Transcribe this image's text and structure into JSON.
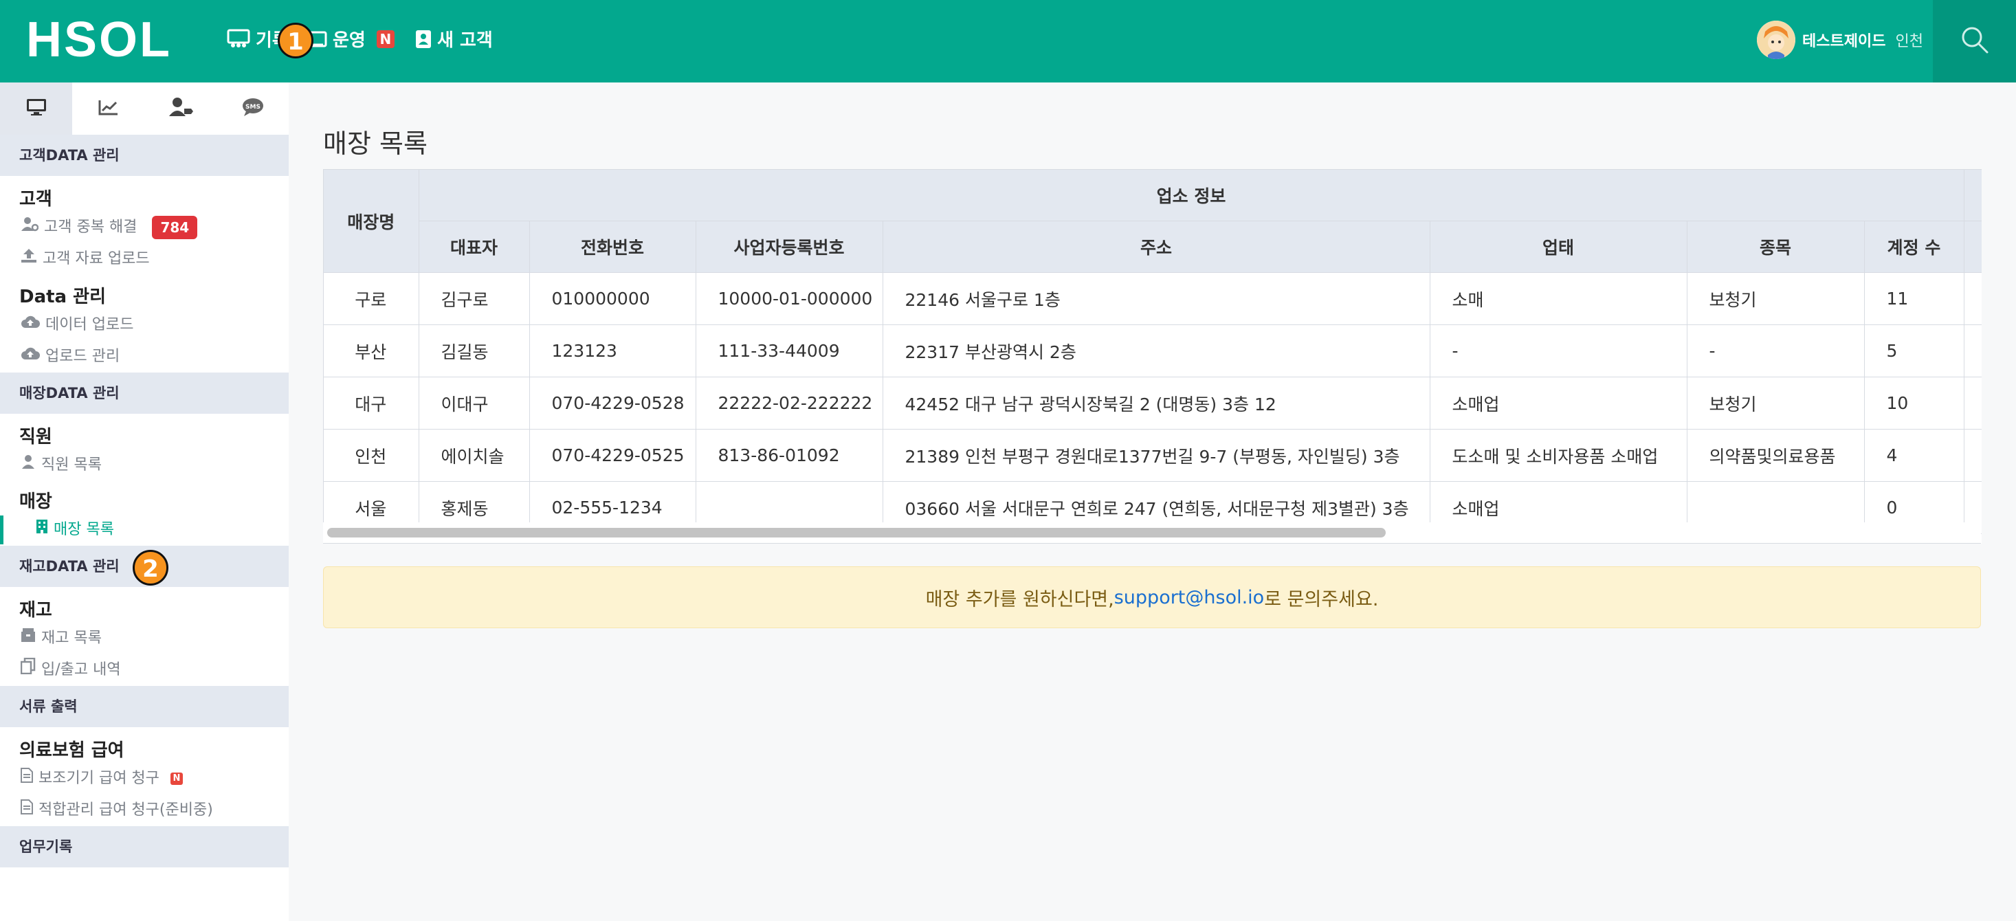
{
  "brand": "HSOL",
  "nav": {
    "items": [
      {
        "label": "기록"
      },
      {
        "label": "운영",
        "badge": "N"
      },
      {
        "label": "새 고객"
      }
    ],
    "marker1": "1"
  },
  "user": {
    "name": "테스트제이드",
    "branch": "인천"
  },
  "sidebar": {
    "tabs": [
      "monitor-icon",
      "chart-icon",
      "user-tag-icon",
      "sms-icon"
    ],
    "sections": {
      "customer_data": "고객DATA 관리",
      "store_data": "매장DATA 관리",
      "inventory_data": "재고DATA 관리",
      "documents": "서류 출력",
      "work_log": "업무기록"
    },
    "groups": {
      "customer": {
        "title": "고객",
        "items": [
          {
            "label": "고객 중복 해결",
            "count": "784"
          },
          {
            "label": "고객 자료 업로드"
          }
        ]
      },
      "data": {
        "title": "Data 관리",
        "items": [
          {
            "label": "데이터 업로드"
          },
          {
            "label": "업로드 관리"
          }
        ]
      },
      "staff": {
        "title": "직원",
        "items": [
          {
            "label": "직원 목록"
          }
        ]
      },
      "store": {
        "title": "매장",
        "items": [
          {
            "label": "매장 목록"
          }
        ]
      },
      "inventory": {
        "title": "재고",
        "items": [
          {
            "label": "재고 목록"
          },
          {
            "label": "입/출고 내역"
          }
        ]
      },
      "insurance": {
        "title": "의료보험 급여",
        "items": [
          {
            "label": "보조기기 급여 청구",
            "badge": "N"
          },
          {
            "label": "적합관리 급여 청구(준비중)"
          }
        ]
      }
    },
    "marker2": "2"
  },
  "main": {
    "title": "매장 목록",
    "table": {
      "group_header": "업소 정보",
      "headers": [
        "매장명",
        "대표자",
        "전화번호",
        "사업자등록번호",
        "주소",
        "업태",
        "종목",
        "계정 수"
      ],
      "rows": [
        [
          "구로",
          "김구로",
          "010000000",
          "10000-01-000000",
          "22146 서울구로 1층",
          "소매",
          "보청기",
          "11"
        ],
        [
          "부산",
          "김길동",
          "123123",
          "111-33-44009",
          "22317 부산광역시 2층",
          "-",
          "-",
          "5"
        ],
        [
          "대구",
          "이대구",
          "070-4229-0528",
          "22222-02-222222",
          "42452 대구 남구 광덕시장북길 2 (대명동) 3층 12",
          "소매업",
          "보청기",
          "10"
        ],
        [
          "인천",
          "에이치솔",
          "070-4229-0525",
          "813-86-01092",
          "21389 인천 부평구 경원대로1377번길 9-7 (부평동, 자인빌딩) 3층",
          "도소매 및 소비자용품 소매업",
          "의약품및의료용품",
          "4"
        ],
        [
          "서울",
          "홍제동",
          "02-555-1234",
          "",
          "03660 서울 서대문구 연희로 247 (연희동, 서대문구청 제3별관) 3층",
          "소매업",
          "",
          "0"
        ]
      ]
    },
    "notice": {
      "prefix": "매장 추가를 원하신다면, ",
      "email": "support@hsol.io",
      "suffix": "로 문의주세요."
    }
  },
  "colors": {
    "primary": "#03a88e",
    "badge_red": "#e0343a",
    "marker_orange": "#f7931e"
  }
}
